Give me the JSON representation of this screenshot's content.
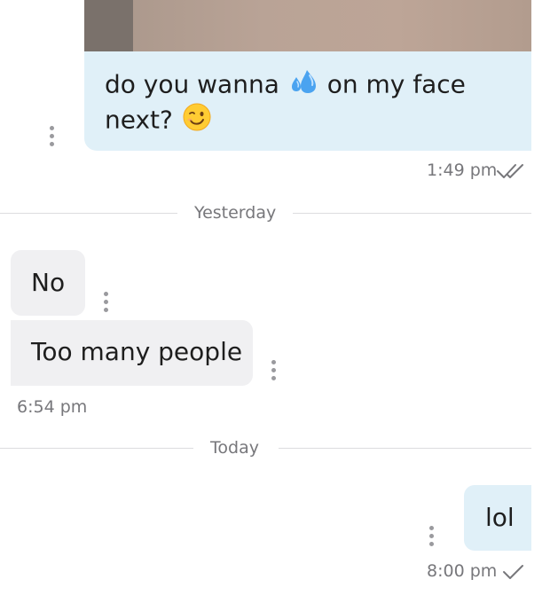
{
  "messages": [
    {
      "text_before": "do you wanna",
      "emoji_1": "sweat-droplets-icon",
      "text_after": "on my face",
      "text_line2": "next?",
      "emoji_2": "winking-face-icon",
      "time": "1:49 pm",
      "status": "read"
    },
    {
      "text": "No"
    },
    {
      "text": "Too many people",
      "time": "6:54 pm"
    },
    {
      "text": "lol",
      "time": "8:00 pm",
      "status": "delivered"
    }
  ],
  "separators": {
    "yesterday": "Yesterday",
    "today": "Today"
  },
  "colors": {
    "outgoing_bubble": "#e0f0f8",
    "incoming_bubble": "#f0f0f2",
    "meta_text": "#77777b"
  }
}
